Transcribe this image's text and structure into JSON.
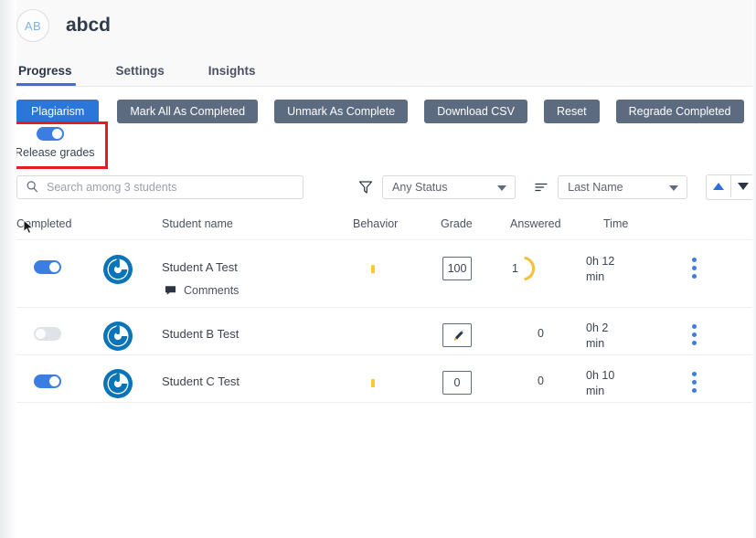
{
  "header": {
    "avatar_initials": "AB",
    "course_title": "abcd",
    "tabs": [
      {
        "label": "Progress",
        "active": true
      },
      {
        "label": "Settings",
        "active": false
      },
      {
        "label": "Insights",
        "active": false
      }
    ]
  },
  "toolbar": {
    "plagiarism_label": "Plagiarism",
    "mark_all_label": "Mark All As Completed",
    "unmark_label": "Unmark As Complete",
    "download_csv_label": "Download CSV",
    "reset_label": "Reset",
    "regrade_label": "Regrade Completed"
  },
  "release_grades": {
    "label": "Release grades",
    "enabled": true
  },
  "filters": {
    "search_placeholder": "Search among 3 students",
    "search_value": "",
    "status_value": "Any Status",
    "sort_value": "Last Name",
    "sort_asc_label": "▲",
    "sort_desc_label": "▼"
  },
  "table": {
    "columns": [
      {
        "key": "completed",
        "label": "Completed"
      },
      {
        "key": "name",
        "label": "Student name"
      },
      {
        "key": "behavior",
        "label": "Behavior"
      },
      {
        "key": "grade",
        "label": "Grade"
      },
      {
        "key": "answered",
        "label": "Answered"
      },
      {
        "key": "time",
        "label": "Time"
      }
    ],
    "rows": [
      {
        "completed": true,
        "name": "Student A Test",
        "comments_label": "Comments",
        "has_comments": true,
        "behavior_flag": true,
        "grade": "100",
        "grade_is_icon": false,
        "answered": "1",
        "answered_has_arc": true,
        "time_hours": "0h 12",
        "time_unit": "min"
      },
      {
        "completed": false,
        "name": "Student B Test",
        "comments_label": "",
        "has_comments": false,
        "behavior_flag": false,
        "grade": "",
        "grade_is_icon": true,
        "answered": "0",
        "answered_has_arc": false,
        "time_hours": "0h 2",
        "time_unit": "min"
      },
      {
        "completed": true,
        "name": "Student C Test",
        "comments_label": "",
        "has_comments": false,
        "behavior_flag": true,
        "grade": "0",
        "grade_is_icon": false,
        "answered": "0",
        "answered_has_arc": false,
        "time_hours": "0h 10",
        "time_unit": "min"
      }
    ]
  },
  "annotation": {
    "color": "#e81b23"
  },
  "colors": {
    "accent_blue": "#3c7de2",
    "button_gray": "#5d6b81",
    "primary_blue": "#2b77d9",
    "behavior_yellow": "#fdc92b",
    "arc_yellow": "#f5c23e"
  }
}
